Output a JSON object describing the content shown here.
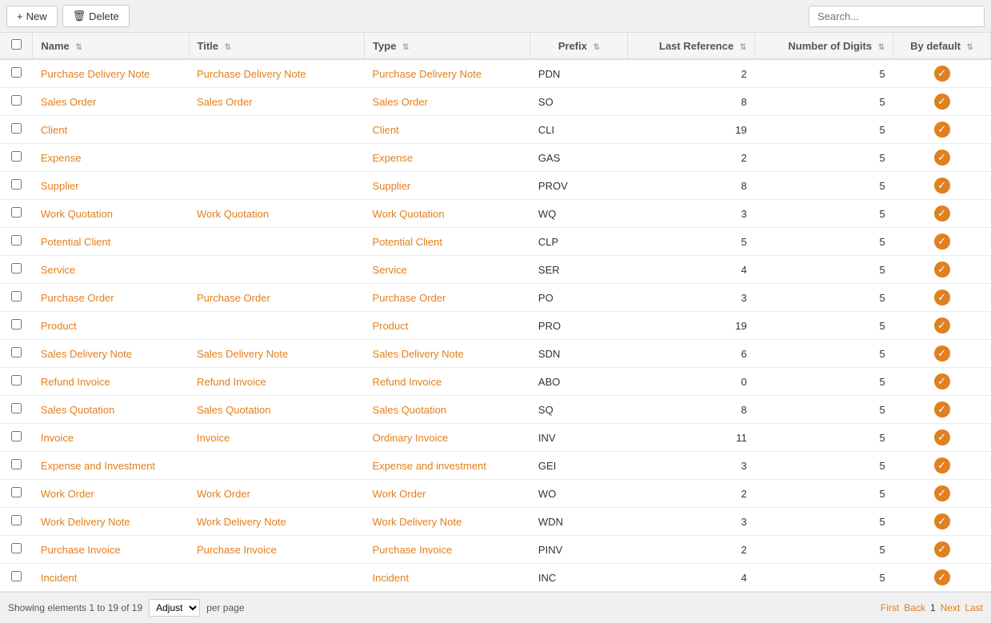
{
  "toolbar": {
    "new_label": "New",
    "delete_label": "Delete",
    "search_placeholder": "Search..."
  },
  "table": {
    "columns": [
      {
        "key": "checkbox",
        "label": ""
      },
      {
        "key": "name",
        "label": "Name",
        "sortable": true
      },
      {
        "key": "title",
        "label": "Title",
        "sortable": true
      },
      {
        "key": "type",
        "label": "Type",
        "sortable": true
      },
      {
        "key": "prefix",
        "label": "Prefix",
        "sortable": true
      },
      {
        "key": "last_reference",
        "label": "Last Reference",
        "sortable": true
      },
      {
        "key": "number_of_digits",
        "label": "Number of Digits",
        "sortable": true
      },
      {
        "key": "by_default",
        "label": "By default",
        "sortable": true
      }
    ],
    "rows": [
      {
        "name": "Purchase Delivery Note",
        "title": "Purchase Delivery Note",
        "type": "Purchase Delivery Note",
        "prefix": "PDN",
        "last_reference": 2,
        "number_of_digits": 5,
        "by_default": true
      },
      {
        "name": "Sales Order",
        "title": "Sales Order",
        "type": "Sales Order",
        "prefix": "SO",
        "last_reference": 8,
        "number_of_digits": 5,
        "by_default": true
      },
      {
        "name": "Client",
        "title": "",
        "type": "Client",
        "prefix": "CLI",
        "last_reference": 19,
        "number_of_digits": 5,
        "by_default": true
      },
      {
        "name": "Expense",
        "title": "",
        "type": "Expense",
        "prefix": "GAS",
        "last_reference": 2,
        "number_of_digits": 5,
        "by_default": true
      },
      {
        "name": "Supplier",
        "title": "",
        "type": "Supplier",
        "prefix": "PROV",
        "last_reference": 8,
        "number_of_digits": 5,
        "by_default": true
      },
      {
        "name": "Work Quotation",
        "title": "Work Quotation",
        "type": "Work Quotation",
        "prefix": "WQ",
        "last_reference": 3,
        "number_of_digits": 5,
        "by_default": true
      },
      {
        "name": "Potential Client",
        "title": "",
        "type": "Potential Client",
        "prefix": "CLP",
        "last_reference": 5,
        "number_of_digits": 5,
        "by_default": true
      },
      {
        "name": "Service",
        "title": "",
        "type": "Service",
        "prefix": "SER",
        "last_reference": 4,
        "number_of_digits": 5,
        "by_default": true
      },
      {
        "name": "Purchase Order",
        "title": "Purchase Order",
        "type": "Purchase Order",
        "prefix": "PO",
        "last_reference": 3,
        "number_of_digits": 5,
        "by_default": true
      },
      {
        "name": "Product",
        "title": "",
        "type": "Product",
        "prefix": "PRO",
        "last_reference": 19,
        "number_of_digits": 5,
        "by_default": true
      },
      {
        "name": "Sales Delivery Note",
        "title": "Sales Delivery Note",
        "type": "Sales Delivery Note",
        "prefix": "SDN",
        "last_reference": 6,
        "number_of_digits": 5,
        "by_default": true
      },
      {
        "name": "Refund Invoice",
        "title": "Refund Invoice",
        "type": "Refund Invoice",
        "prefix": "ABO",
        "last_reference": 0,
        "number_of_digits": 5,
        "by_default": true
      },
      {
        "name": "Sales Quotation",
        "title": "Sales Quotation",
        "type": "Sales Quotation",
        "prefix": "SQ",
        "last_reference": 8,
        "number_of_digits": 5,
        "by_default": true
      },
      {
        "name": "Invoice",
        "title": "Invoice",
        "type": "Ordinary Invoice",
        "prefix": "INV",
        "last_reference": 11,
        "number_of_digits": 5,
        "by_default": true
      },
      {
        "name": "Expense and Investment",
        "title": "",
        "type": "Expense and investment",
        "prefix": "GEI",
        "last_reference": 3,
        "number_of_digits": 5,
        "by_default": true
      },
      {
        "name": "Work Order",
        "title": "Work Order",
        "type": "Work Order",
        "prefix": "WO",
        "last_reference": 2,
        "number_of_digits": 5,
        "by_default": true
      },
      {
        "name": "Work Delivery Note",
        "title": "Work Delivery Note",
        "type": "Work Delivery Note",
        "prefix": "WDN",
        "last_reference": 3,
        "number_of_digits": 5,
        "by_default": true
      },
      {
        "name": "Purchase Invoice",
        "title": "Purchase Invoice",
        "type": "Purchase Invoice",
        "prefix": "PINV",
        "last_reference": 2,
        "number_of_digits": 5,
        "by_default": true
      },
      {
        "name": "Incident",
        "title": "",
        "type": "Incident",
        "prefix": "INC",
        "last_reference": 4,
        "number_of_digits": 5,
        "by_default": true
      }
    ]
  },
  "footer": {
    "showing_prefix": "Showing elements",
    "range_start": 1,
    "range_end": 19,
    "total": 19,
    "showing_text": "Showing elements 1 to 19 of 19",
    "per_page_label": "per page",
    "per_page_value": "Adjust",
    "pagination": {
      "first": "First",
      "back": "Back",
      "page": "1",
      "next": "Next",
      "last": "Last"
    }
  }
}
